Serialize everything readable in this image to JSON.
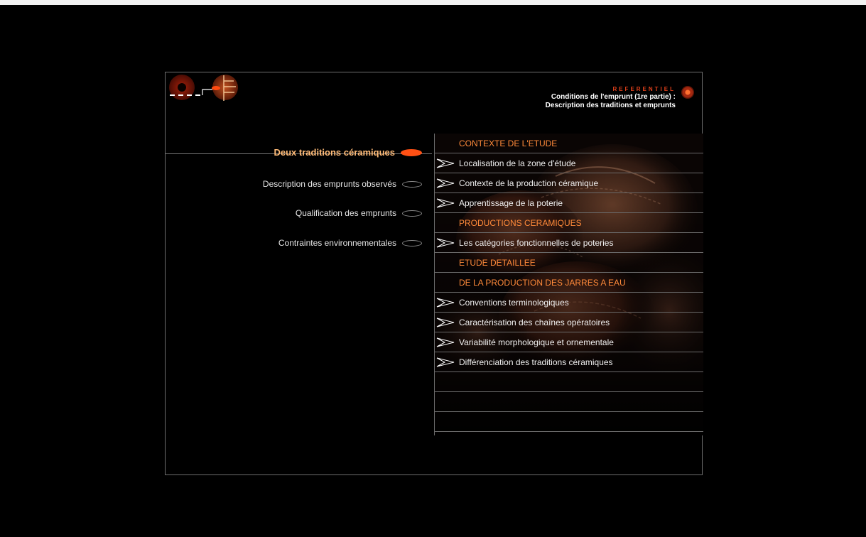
{
  "header": {
    "section_label": "REFERENTIEL",
    "subtitle_line1": "Conditions de l'emprunt (1re partie) :",
    "subtitle_line2": "Description des traditions et emprunts"
  },
  "left_nav": [
    {
      "label": "Deux traditions céramiques",
      "active": true
    },
    {
      "label": "Description des emprunts observés",
      "active": false
    },
    {
      "label": "Qualification des emprunts",
      "active": false
    },
    {
      "label": "Contraintes environnementales",
      "active": false
    }
  ],
  "right_menu": [
    {
      "label": "CONTEXTE DE L'ETUDE",
      "type": "section"
    },
    {
      "label": "Localisation de la zone d'étude",
      "type": "link"
    },
    {
      "label": "Contexte de la production céramique",
      "type": "link"
    },
    {
      "label": "Apprentissage de la poterie",
      "type": "link"
    },
    {
      "label": "PRODUCTIONS CERAMIQUES",
      "type": "section"
    },
    {
      "label": "Les catégories fonctionnelles de poteries",
      "type": "link"
    },
    {
      "label": "ETUDE DETAILLEE",
      "type": "section"
    },
    {
      "label": "DE LA PRODUCTION DES JARRES A EAU",
      "type": "section"
    },
    {
      "label": "Conventions terminologiques",
      "type": "link"
    },
    {
      "label": "Caractérisation des chaînes opératoires",
      "type": "link"
    },
    {
      "label": "Variabilité morphologique et ornementale",
      "type": "link"
    },
    {
      "label": "Différenciation des traditions céramiques",
      "type": "link"
    },
    {
      "label": "",
      "type": "empty"
    },
    {
      "label": "",
      "type": "empty"
    },
    {
      "label": "",
      "type": "empty"
    }
  ],
  "colors": {
    "accent": "#ff5014",
    "section_text": "#ff8a3a",
    "active_nav_text": "#ffbb77",
    "background": "#000000"
  }
}
